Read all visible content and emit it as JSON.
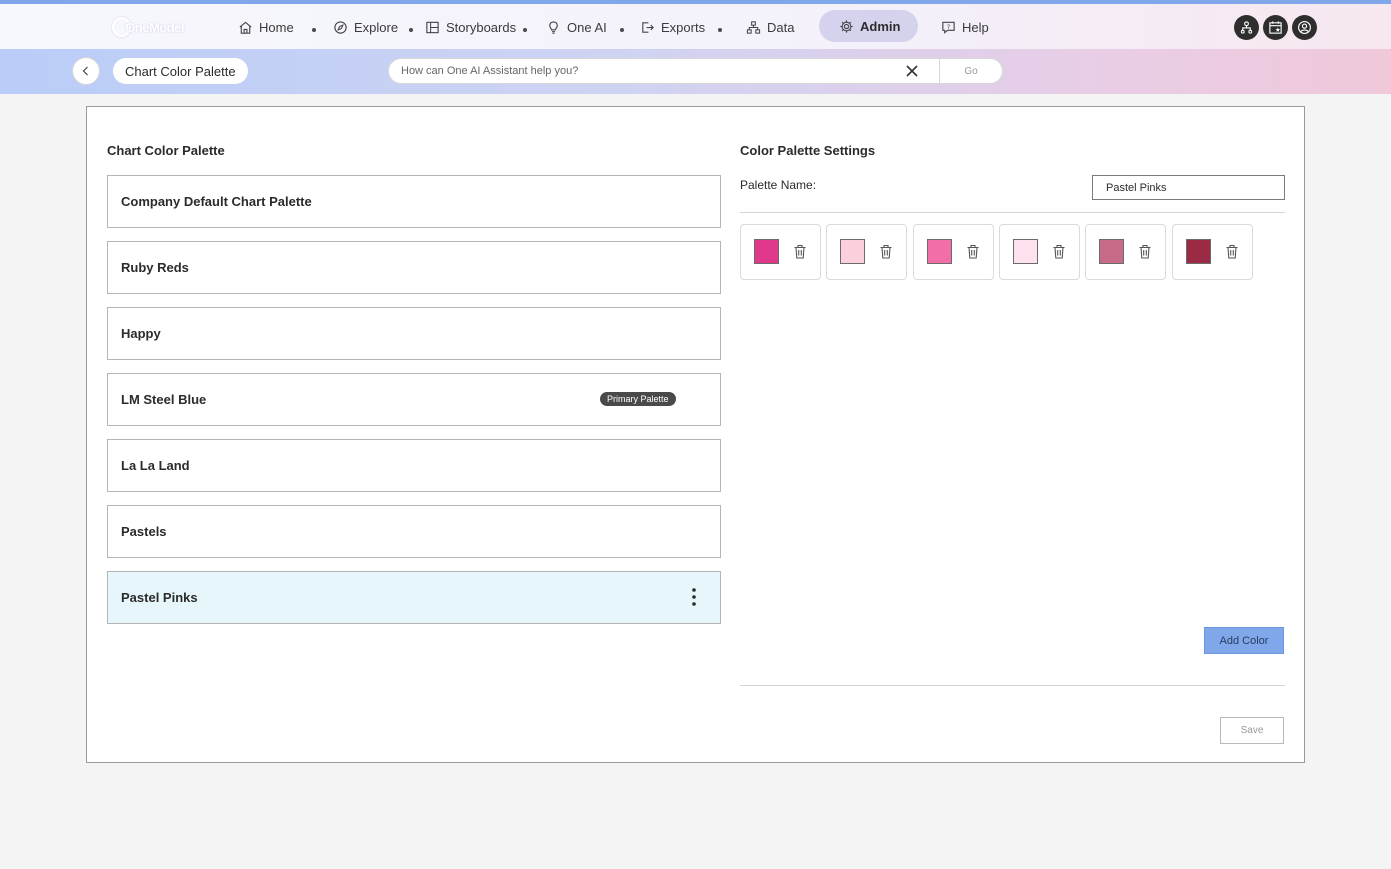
{
  "nav": {
    "logo": "OneModel",
    "items": [
      {
        "label": "Home"
      },
      {
        "label": "Explore"
      },
      {
        "label": "Storyboards"
      },
      {
        "label": "One AI"
      },
      {
        "label": "Exports"
      },
      {
        "label": "Data"
      },
      {
        "label": "Admin"
      },
      {
        "label": "Help"
      }
    ],
    "active": "Admin"
  },
  "subbar": {
    "breadcrumb": "Chart Color Palette",
    "assistant_placeholder": "How can One AI Assistant help you?",
    "go_label": "Go"
  },
  "left": {
    "title": "Chart Color Palette",
    "palettes": [
      {
        "name": "Company Default Chart Palette"
      },
      {
        "name": "Ruby Reds"
      },
      {
        "name": "Happy"
      },
      {
        "name": "LM Steel Blue",
        "badge": "Primary Palette"
      },
      {
        "name": "La La Land"
      },
      {
        "name": "Pastels"
      },
      {
        "name": "Pastel Pinks",
        "selected": true
      }
    ]
  },
  "right": {
    "title": "Color Palette Settings",
    "name_label": "Palette Name:",
    "name_value": "Pastel Pinks",
    "colors": [
      "#e0398c",
      "#fbcfdc",
      "#f26ea8",
      "#fde1ee",
      "#c86b86",
      "#9b2b45"
    ],
    "add_color_label": "Add Color",
    "save_label": "Save"
  }
}
